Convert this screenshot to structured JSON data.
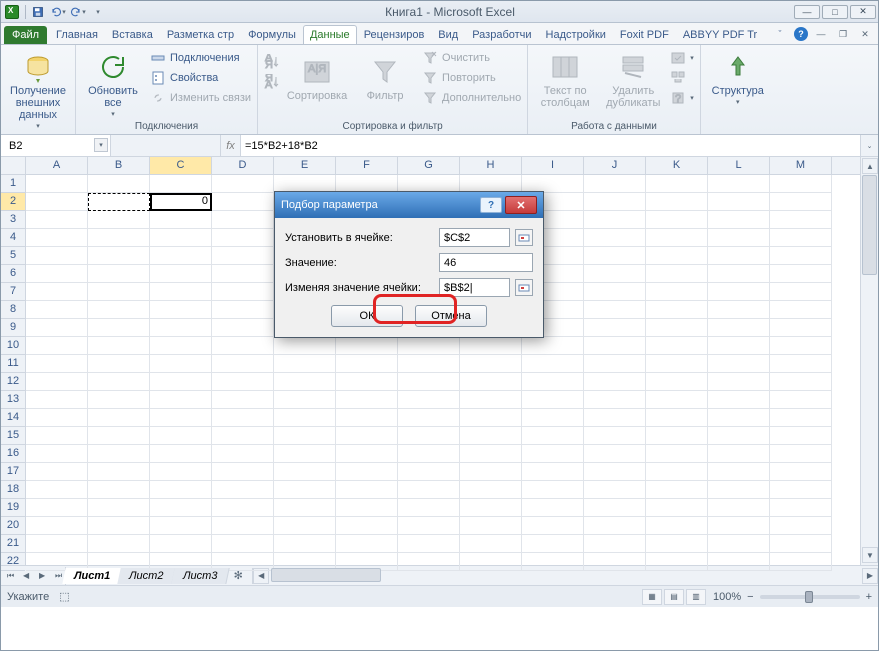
{
  "title": "Книга1 - Microsoft Excel",
  "tabs": {
    "file": "Файл",
    "list": [
      "Главная",
      "Вставка",
      "Разметка стр",
      "Формулы",
      "Данные",
      "Рецензиров",
      "Вид",
      "Разработчи",
      "Надстройки",
      "Foxit PDF",
      "ABBYY PDF Tr"
    ],
    "active_index": 4
  },
  "ribbon": {
    "g0": {
      "btn": "Получение\nвнешних данных",
      "label": ""
    },
    "g1": {
      "refresh": "Обновить\nвсе",
      "connections": "Подключения",
      "properties": "Свойства",
      "edit_links": "Изменить связи",
      "label": "Подключения"
    },
    "g2": {
      "sort": "Сортировка",
      "filter": "Фильтр",
      "clear": "Очистить",
      "reapply": "Повторить",
      "advanced": "Дополнительно",
      "label": "Сортировка и фильтр"
    },
    "g3": {
      "t2c": "Текст по\nстолбцам",
      "rmdup": "Удалить\nдубликаты",
      "label": "Работа с данными"
    },
    "g4": {
      "outline": "Структура",
      "label": ""
    }
  },
  "namebox": "B2",
  "formula": "=15*B2+18*B2",
  "cols": [
    "A",
    "B",
    "C",
    "D",
    "E",
    "F",
    "G",
    "H",
    "I",
    "J",
    "K",
    "L",
    "M"
  ],
  "rows_count": 22,
  "cell_c2": "0",
  "dialog": {
    "title": "Подбор параметра",
    "set_cell_lbl": "Установить в ячейке:",
    "set_cell_val": "$C$2",
    "to_value_lbl": "Значение:",
    "to_value_val": "46",
    "by_changing_lbl": "Изменяя значение ячейки:",
    "by_changing_val": "$B$2|",
    "ok": "ОК",
    "cancel": "Отмена"
  },
  "sheets": {
    "list": [
      "Лист1",
      "Лист2",
      "Лист3"
    ],
    "active": 0
  },
  "status": {
    "mode": "Укажите",
    "zoom": "100%"
  }
}
